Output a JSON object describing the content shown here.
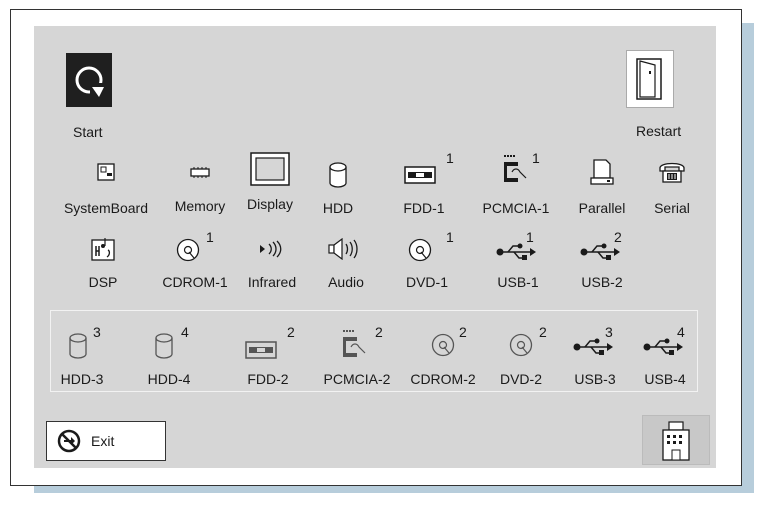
{
  "top": {
    "start_label": "Start",
    "restart_label": "Restart"
  },
  "devices_row1": [
    {
      "label": "SystemBoard",
      "sup": ""
    },
    {
      "label": "Memory",
      "sup": ""
    },
    {
      "label": "Display",
      "sup": ""
    },
    {
      "label": "HDD",
      "sup": ""
    },
    {
      "label": "FDD-1",
      "sup": "1"
    },
    {
      "label": "PCMCIA-1",
      "sup": "1"
    },
    {
      "label": "Parallel",
      "sup": ""
    },
    {
      "label": "Serial",
      "sup": ""
    }
  ],
  "devices_row2": [
    {
      "label": "DSP",
      "sup": ""
    },
    {
      "label": "CDROM-1",
      "sup": "1"
    },
    {
      "label": "Infrared",
      "sup": ""
    },
    {
      "label": "Audio",
      "sup": ""
    },
    {
      "label": "DVD-1",
      "sup": "1"
    },
    {
      "label": "USB-1",
      "sup": "1"
    },
    {
      "label": "USB-2",
      "sup": "2"
    }
  ],
  "devices_row3": [
    {
      "label": "HDD-3",
      "sup": "3"
    },
    {
      "label": "HDD-4",
      "sup": "4"
    },
    {
      "label": "FDD-2",
      "sup": "2"
    },
    {
      "label": "PCMCIA-2",
      "sup": "2"
    },
    {
      "label": "CDROM-2",
      "sup": "2"
    },
    {
      "label": "DVD-2",
      "sup": "2"
    },
    {
      "label": "USB-3",
      "sup": "3"
    },
    {
      "label": "USB-4",
      "sup": "4"
    }
  ],
  "footer": {
    "exit_label": "Exit"
  },
  "colors": {
    "panel": "#d6d6d6",
    "shadow": "#b7cddb",
    "start_bg": "#1f1f1f"
  }
}
